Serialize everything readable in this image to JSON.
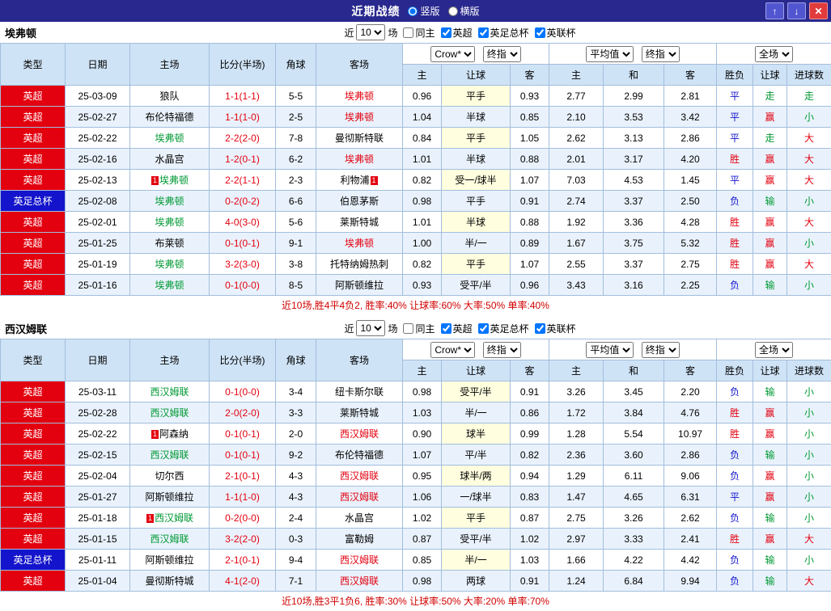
{
  "titlebar": {
    "title": "近期战绩",
    "vertical": "竖版",
    "horizontal": "横版",
    "vertical_selected": true,
    "horizontal_selected": false,
    "up_icon": "↑",
    "down_icon": "↓",
    "close_icon": "✕"
  },
  "filter": {
    "near": "近",
    "count": "10",
    "matches": "场",
    "items": [
      {
        "label": "同主",
        "checked": false
      },
      {
        "label": "英超",
        "checked": true
      },
      {
        "label": "英足总杯",
        "checked": true
      },
      {
        "label": "英联杯",
        "checked": true
      }
    ]
  },
  "header": {
    "left": [
      "类型",
      "日期",
      "主场",
      "比分(半场)",
      "角球",
      "客场"
    ],
    "crow": "Crow*",
    "final": "终指",
    "avg": "平均值",
    "full": "全场",
    "odds": [
      "主",
      "让球",
      "客"
    ],
    "avgcols": [
      "主",
      "和",
      "客"
    ],
    "result": [
      "胜负",
      "让球",
      "进球数"
    ]
  },
  "colors": {
    "team": {
      "green": "#009933",
      "red": "#e3000f",
      "black": "#000000"
    },
    "league": {
      "英超": "#e3000f",
      "英足总杯": "#1414cc"
    },
    "result": {
      "胜": "#e3000f",
      "平": "#1414cc",
      "负": "#1414cc",
      "赢": "#e3000f",
      "输": "#009933",
      "走": "#009933",
      "大": "#e3000f",
      "小": "#009933"
    }
  },
  "sections": [
    {
      "team": "埃弗顿",
      "summary": "近10场,胜4平4负2, 胜率:40% 让球率:60% 大率:50% 单率:40%",
      "rows": [
        {
          "lg": "英超",
          "date": "25-03-09",
          "home": "狼队",
          "hc": "black",
          "hb": false,
          "score": "1-1(1-1)",
          "corner": "5-5",
          "away": "埃弗顿",
          "ac": "red",
          "ab": false,
          "o1": "0.96",
          "hcap": "平手",
          "o2": "0.93",
          "a1": "2.77",
          "a2": "2.99",
          "a3": "2.81",
          "r1": "平",
          "r2": "走",
          "r3": "走"
        },
        {
          "lg": "英超",
          "date": "25-02-27",
          "home": "布伦特福德",
          "hc": "black",
          "hb": false,
          "score": "1-1(1-0)",
          "corner": "2-5",
          "away": "埃弗顿",
          "ac": "red",
          "ab": false,
          "o1": "1.04",
          "hcap": "半球",
          "o2": "0.85",
          "a1": "2.10",
          "a2": "3.53",
          "a3": "3.42",
          "r1": "平",
          "r2": "赢",
          "r3": "小"
        },
        {
          "lg": "英超",
          "date": "25-02-22",
          "home": "埃弗顿",
          "hc": "green",
          "hb": false,
          "score": "2-2(2-0)",
          "corner": "7-8",
          "away": "曼彻斯特联",
          "ac": "black",
          "ab": false,
          "o1": "0.84",
          "hcap": "平手",
          "o2": "1.05",
          "a1": "2.62",
          "a2": "3.13",
          "a3": "2.86",
          "r1": "平",
          "r2": "走",
          "r3": "大"
        },
        {
          "lg": "英超",
          "date": "25-02-16",
          "home": "水晶宫",
          "hc": "black",
          "hb": false,
          "score": "1-2(0-1)",
          "corner": "6-2",
          "away": "埃弗顿",
          "ac": "red",
          "ab": false,
          "o1": "1.01",
          "hcap": "半球",
          "o2": "0.88",
          "a1": "2.01",
          "a2": "3.17",
          "a3": "4.20",
          "r1": "胜",
          "r2": "赢",
          "r3": "大"
        },
        {
          "lg": "英超",
          "date": "25-02-13",
          "home": "埃弗顿",
          "hc": "green",
          "hb": true,
          "score": "2-2(1-1)",
          "corner": "2-3",
          "away": "利物浦",
          "ac": "black",
          "ab": true,
          "o1": "0.82",
          "hcap": "受一/球半",
          "o2": "1.07",
          "a1": "7.03",
          "a2": "4.53",
          "a3": "1.45",
          "r1": "平",
          "r2": "赢",
          "r3": "大"
        },
        {
          "lg": "英足总杯",
          "date": "25-02-08",
          "home": "埃弗顿",
          "hc": "green",
          "hb": false,
          "score": "0-2(0-2)",
          "corner": "6-6",
          "away": "伯恩茅斯",
          "ac": "black",
          "ab": false,
          "o1": "0.98",
          "hcap": "平手",
          "o2": "0.91",
          "a1": "2.74",
          "a2": "3.37",
          "a3": "2.50",
          "r1": "负",
          "r2": "输",
          "r3": "小"
        },
        {
          "lg": "英超",
          "date": "25-02-01",
          "home": "埃弗顿",
          "hc": "green",
          "hb": false,
          "score": "4-0(3-0)",
          "corner": "5-6",
          "away": "莱斯特城",
          "ac": "black",
          "ab": false,
          "o1": "1.01",
          "hcap": "半球",
          "o2": "0.88",
          "a1": "1.92",
          "a2": "3.36",
          "a3": "4.28",
          "r1": "胜",
          "r2": "赢",
          "r3": "大"
        },
        {
          "lg": "英超",
          "date": "25-01-25",
          "home": "布莱顿",
          "hc": "black",
          "hb": false,
          "score": "0-1(0-1)",
          "corner": "9-1",
          "away": "埃弗顿",
          "ac": "red",
          "ab": false,
          "o1": "1.00",
          "hcap": "半/一",
          "o2": "0.89",
          "a1": "1.67",
          "a2": "3.75",
          "a3": "5.32",
          "r1": "胜",
          "r2": "赢",
          "r3": "小"
        },
        {
          "lg": "英超",
          "date": "25-01-19",
          "home": "埃弗顿",
          "hc": "green",
          "hb": false,
          "score": "3-2(3-0)",
          "corner": "3-8",
          "away": "托特纳姆热刺",
          "ac": "black",
          "ab": false,
          "o1": "0.82",
          "hcap": "平手",
          "o2": "1.07",
          "a1": "2.55",
          "a2": "3.37",
          "a3": "2.75",
          "r1": "胜",
          "r2": "赢",
          "r3": "大"
        },
        {
          "lg": "英超",
          "date": "25-01-16",
          "home": "埃弗顿",
          "hc": "green",
          "hb": false,
          "score": "0-1(0-0)",
          "corner": "8-5",
          "away": "阿斯顿维拉",
          "ac": "black",
          "ab": false,
          "o1": "0.93",
          "hcap": "受平/半",
          "o2": "0.96",
          "a1": "3.43",
          "a2": "3.16",
          "a3": "2.25",
          "r1": "负",
          "r2": "输",
          "r3": "小"
        }
      ]
    },
    {
      "team": "西汉姆联",
      "summary": "近10场,胜3平1负6, 胜率:30% 让球率:50% 大率:20% 单率:70%",
      "rows": [
        {
          "lg": "英超",
          "date": "25-03-11",
          "home": "西汉姆联",
          "hc": "green",
          "hb": false,
          "score": "0-1(0-0)",
          "corner": "3-4",
          "away": "纽卡斯尔联",
          "ac": "black",
          "ab": false,
          "o1": "0.98",
          "hcap": "受平/半",
          "o2": "0.91",
          "a1": "3.26",
          "a2": "3.45",
          "a3": "2.20",
          "r1": "负",
          "r2": "输",
          "r3": "小"
        },
        {
          "lg": "英超",
          "date": "25-02-28",
          "home": "西汉姆联",
          "hc": "green",
          "hb": false,
          "score": "2-0(2-0)",
          "corner": "3-3",
          "away": "莱斯特城",
          "ac": "black",
          "ab": false,
          "o1": "1.03",
          "hcap": "半/一",
          "o2": "0.86",
          "a1": "1.72",
          "a2": "3.84",
          "a3": "4.76",
          "r1": "胜",
          "r2": "赢",
          "r3": "小"
        },
        {
          "lg": "英超",
          "date": "25-02-22",
          "home": "阿森纳",
          "hc": "black",
          "hb": true,
          "score": "0-1(0-1)",
          "corner": "2-0",
          "away": "西汉姆联",
          "ac": "red",
          "ab": false,
          "o1": "0.90",
          "hcap": "球半",
          "o2": "0.99",
          "a1": "1.28",
          "a2": "5.54",
          "a3": "10.97",
          "r1": "胜",
          "r2": "赢",
          "r3": "小"
        },
        {
          "lg": "英超",
          "date": "25-02-15",
          "home": "西汉姆联",
          "hc": "green",
          "hb": false,
          "score": "0-1(0-1)",
          "corner": "9-2",
          "away": "布伦特福德",
          "ac": "black",
          "ab": false,
          "o1": "1.07",
          "hcap": "平/半",
          "o2": "0.82",
          "a1": "2.36",
          "a2": "3.60",
          "a3": "2.86",
          "r1": "负",
          "r2": "输",
          "r3": "小"
        },
        {
          "lg": "英超",
          "date": "25-02-04",
          "home": "切尔西",
          "hc": "black",
          "hb": false,
          "score": "2-1(0-1)",
          "corner": "4-3",
          "away": "西汉姆联",
          "ac": "red",
          "ab": false,
          "o1": "0.95",
          "hcap": "球半/两",
          "o2": "0.94",
          "a1": "1.29",
          "a2": "6.11",
          "a3": "9.06",
          "r1": "负",
          "r2": "赢",
          "r3": "小"
        },
        {
          "lg": "英超",
          "date": "25-01-27",
          "home": "阿斯顿维拉",
          "hc": "black",
          "hb": false,
          "score": "1-1(1-0)",
          "corner": "4-3",
          "away": "西汉姆联",
          "ac": "red",
          "ab": false,
          "o1": "1.06",
          "hcap": "一/球半",
          "o2": "0.83",
          "a1": "1.47",
          "a2": "4.65",
          "a3": "6.31",
          "r1": "平",
          "r2": "赢",
          "r3": "小"
        },
        {
          "lg": "英超",
          "date": "25-01-18",
          "home": "西汉姆联",
          "hc": "green",
          "hb": true,
          "score": "0-2(0-0)",
          "corner": "2-4",
          "away": "水晶宫",
          "ac": "black",
          "ab": false,
          "o1": "1.02",
          "hcap": "平手",
          "o2": "0.87",
          "a1": "2.75",
          "a2": "3.26",
          "a3": "2.62",
          "r1": "负",
          "r2": "输",
          "r3": "小"
        },
        {
          "lg": "英超",
          "date": "25-01-15",
          "home": "西汉姆联",
          "hc": "green",
          "hb": false,
          "score": "3-2(2-0)",
          "corner": "0-3",
          "away": "富勒姆",
          "ac": "black",
          "ab": false,
          "o1": "0.87",
          "hcap": "受平/半",
          "o2": "1.02",
          "a1": "2.97",
          "a2": "3.33",
          "a3": "2.41",
          "r1": "胜",
          "r2": "赢",
          "r3": "大"
        },
        {
          "lg": "英足总杯",
          "date": "25-01-11",
          "home": "阿斯顿维拉",
          "hc": "black",
          "hb": false,
          "score": "2-1(0-1)",
          "corner": "9-4",
          "away": "西汉姆联",
          "ac": "red",
          "ab": false,
          "o1": "0.85",
          "hcap": "半/一",
          "o2": "1.03",
          "a1": "1.66",
          "a2": "4.22",
          "a3": "4.42",
          "r1": "负",
          "r2": "输",
          "r3": "小"
        },
        {
          "lg": "英超",
          "date": "25-01-04",
          "home": "曼彻斯特城",
          "hc": "black",
          "hb": false,
          "score": "4-1(2-0)",
          "corner": "7-1",
          "away": "西汉姆联",
          "ac": "red",
          "ab": false,
          "o1": "0.98",
          "hcap": "两球",
          "o2": "0.91",
          "a1": "1.24",
          "a2": "6.84",
          "a3": "9.94",
          "r1": "负",
          "r2": "输",
          "r3": "大"
        }
      ]
    }
  ]
}
